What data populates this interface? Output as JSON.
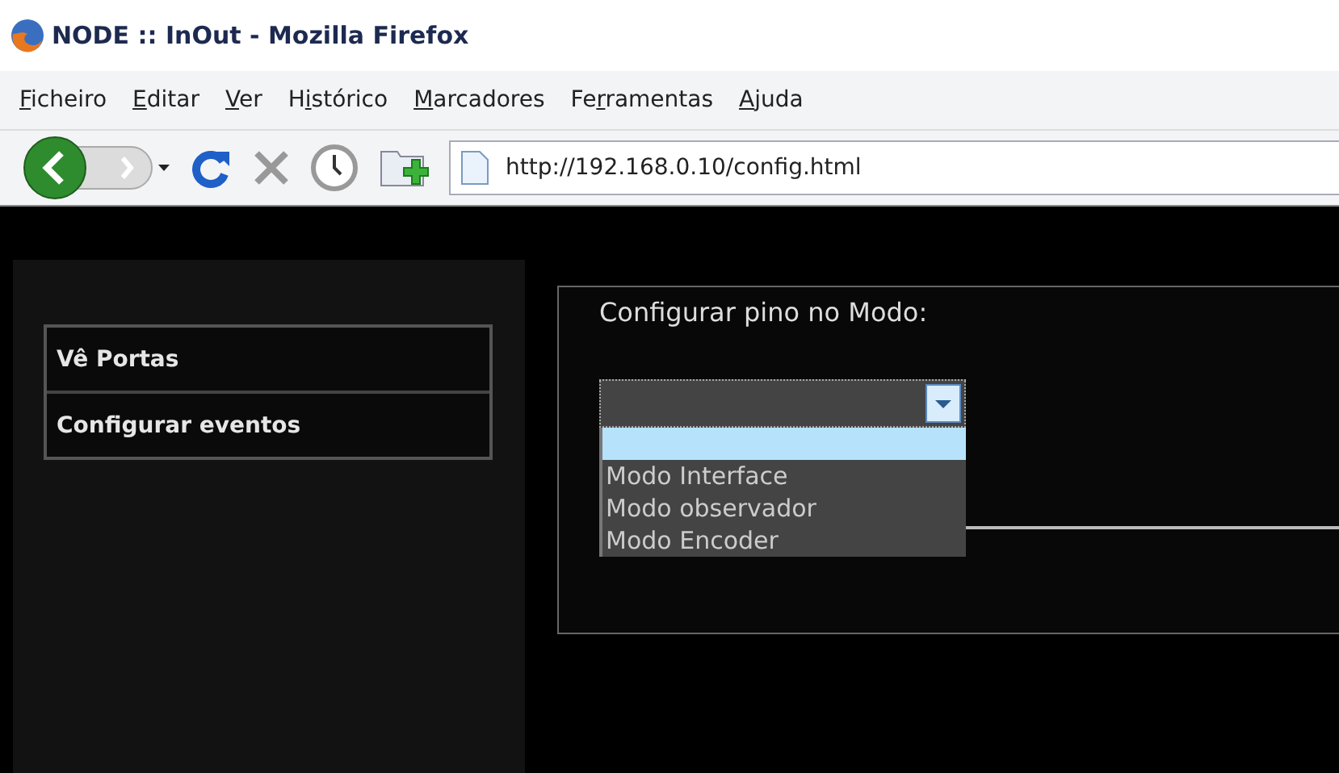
{
  "window": {
    "title": "NODE :: InOut - Mozilla Firefox"
  },
  "menu": [
    {
      "key": "F",
      "after": "icheiro"
    },
    {
      "key": "E",
      "after": "ditar"
    },
    {
      "key": "V",
      "after": "er"
    },
    {
      "before": "H",
      "key": "i",
      "after": "stórico"
    },
    {
      "key": "M",
      "after": "arcadores"
    },
    {
      "before": "Fe",
      "key": "r",
      "after": "ramentas"
    },
    {
      "key": "A",
      "after": "juda"
    }
  ],
  "toolbar": {
    "address": "http://192.168.0.10/config.html"
  },
  "sidebar": {
    "items": [
      {
        "label": "Vê Portas"
      },
      {
        "label": "Configurar eventos"
      }
    ]
  },
  "panel": {
    "title": "Configurar pino no Modo:",
    "dropdown": {
      "expanded": true,
      "options": [
        {
          "selected": true
        },
        {
          "label": "Modo Interface",
          "selected": false
        },
        {
          "label": "Modo observador",
          "selected": false
        },
        {
          "label": "Modo Encoder",
          "selected": false
        }
      ]
    }
  }
}
